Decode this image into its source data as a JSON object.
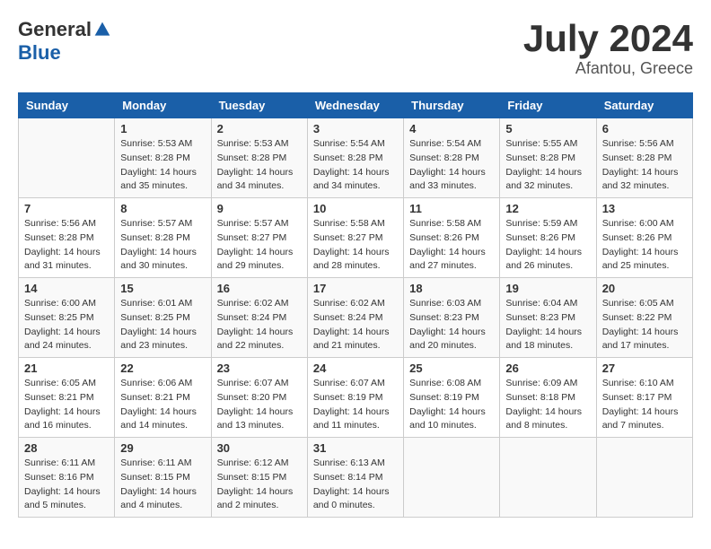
{
  "header": {
    "logo_general": "General",
    "logo_blue": "Blue",
    "month": "July 2024",
    "location": "Afantou, Greece"
  },
  "days_of_week": [
    "Sunday",
    "Monday",
    "Tuesday",
    "Wednesday",
    "Thursday",
    "Friday",
    "Saturday"
  ],
  "weeks": [
    [
      {
        "day": "",
        "sunrise": "",
        "sunset": "",
        "daylight": ""
      },
      {
        "day": "1",
        "sunrise": "5:53 AM",
        "sunset": "8:28 PM",
        "daylight": "14 hours and 35 minutes."
      },
      {
        "day": "2",
        "sunrise": "5:53 AM",
        "sunset": "8:28 PM",
        "daylight": "14 hours and 34 minutes."
      },
      {
        "day": "3",
        "sunrise": "5:54 AM",
        "sunset": "8:28 PM",
        "daylight": "14 hours and 34 minutes."
      },
      {
        "day": "4",
        "sunrise": "5:54 AM",
        "sunset": "8:28 PM",
        "daylight": "14 hours and 33 minutes."
      },
      {
        "day": "5",
        "sunrise": "5:55 AM",
        "sunset": "8:28 PM",
        "daylight": "14 hours and 32 minutes."
      },
      {
        "day": "6",
        "sunrise": "5:56 AM",
        "sunset": "8:28 PM",
        "daylight": "14 hours and 32 minutes."
      }
    ],
    [
      {
        "day": "7",
        "sunrise": "5:56 AM",
        "sunset": "8:28 PM",
        "daylight": "14 hours and 31 minutes."
      },
      {
        "day": "8",
        "sunrise": "5:57 AM",
        "sunset": "8:28 PM",
        "daylight": "14 hours and 30 minutes."
      },
      {
        "day": "9",
        "sunrise": "5:57 AM",
        "sunset": "8:27 PM",
        "daylight": "14 hours and 29 minutes."
      },
      {
        "day": "10",
        "sunrise": "5:58 AM",
        "sunset": "8:27 PM",
        "daylight": "14 hours and 28 minutes."
      },
      {
        "day": "11",
        "sunrise": "5:58 AM",
        "sunset": "8:26 PM",
        "daylight": "14 hours and 27 minutes."
      },
      {
        "day": "12",
        "sunrise": "5:59 AM",
        "sunset": "8:26 PM",
        "daylight": "14 hours and 26 minutes."
      },
      {
        "day": "13",
        "sunrise": "6:00 AM",
        "sunset": "8:26 PM",
        "daylight": "14 hours and 25 minutes."
      }
    ],
    [
      {
        "day": "14",
        "sunrise": "6:00 AM",
        "sunset": "8:25 PM",
        "daylight": "14 hours and 24 minutes."
      },
      {
        "day": "15",
        "sunrise": "6:01 AM",
        "sunset": "8:25 PM",
        "daylight": "14 hours and 23 minutes."
      },
      {
        "day": "16",
        "sunrise": "6:02 AM",
        "sunset": "8:24 PM",
        "daylight": "14 hours and 22 minutes."
      },
      {
        "day": "17",
        "sunrise": "6:02 AM",
        "sunset": "8:24 PM",
        "daylight": "14 hours and 21 minutes."
      },
      {
        "day": "18",
        "sunrise": "6:03 AM",
        "sunset": "8:23 PM",
        "daylight": "14 hours and 20 minutes."
      },
      {
        "day": "19",
        "sunrise": "6:04 AM",
        "sunset": "8:23 PM",
        "daylight": "14 hours and 18 minutes."
      },
      {
        "day": "20",
        "sunrise": "6:05 AM",
        "sunset": "8:22 PM",
        "daylight": "14 hours and 17 minutes."
      }
    ],
    [
      {
        "day": "21",
        "sunrise": "6:05 AM",
        "sunset": "8:21 PM",
        "daylight": "14 hours and 16 minutes."
      },
      {
        "day": "22",
        "sunrise": "6:06 AM",
        "sunset": "8:21 PM",
        "daylight": "14 hours and 14 minutes."
      },
      {
        "day": "23",
        "sunrise": "6:07 AM",
        "sunset": "8:20 PM",
        "daylight": "14 hours and 13 minutes."
      },
      {
        "day": "24",
        "sunrise": "6:07 AM",
        "sunset": "8:19 PM",
        "daylight": "14 hours and 11 minutes."
      },
      {
        "day": "25",
        "sunrise": "6:08 AM",
        "sunset": "8:19 PM",
        "daylight": "14 hours and 10 minutes."
      },
      {
        "day": "26",
        "sunrise": "6:09 AM",
        "sunset": "8:18 PM",
        "daylight": "14 hours and 8 minutes."
      },
      {
        "day": "27",
        "sunrise": "6:10 AM",
        "sunset": "8:17 PM",
        "daylight": "14 hours and 7 minutes."
      }
    ],
    [
      {
        "day": "28",
        "sunrise": "6:11 AM",
        "sunset": "8:16 PM",
        "daylight": "14 hours and 5 minutes."
      },
      {
        "day": "29",
        "sunrise": "6:11 AM",
        "sunset": "8:15 PM",
        "daylight": "14 hours and 4 minutes."
      },
      {
        "day": "30",
        "sunrise": "6:12 AM",
        "sunset": "8:15 PM",
        "daylight": "14 hours and 2 minutes."
      },
      {
        "day": "31",
        "sunrise": "6:13 AM",
        "sunset": "8:14 PM",
        "daylight": "14 hours and 0 minutes."
      },
      {
        "day": "",
        "sunrise": "",
        "sunset": "",
        "daylight": ""
      },
      {
        "day": "",
        "sunrise": "",
        "sunset": "",
        "daylight": ""
      },
      {
        "day": "",
        "sunrise": "",
        "sunset": "",
        "daylight": ""
      }
    ]
  ]
}
